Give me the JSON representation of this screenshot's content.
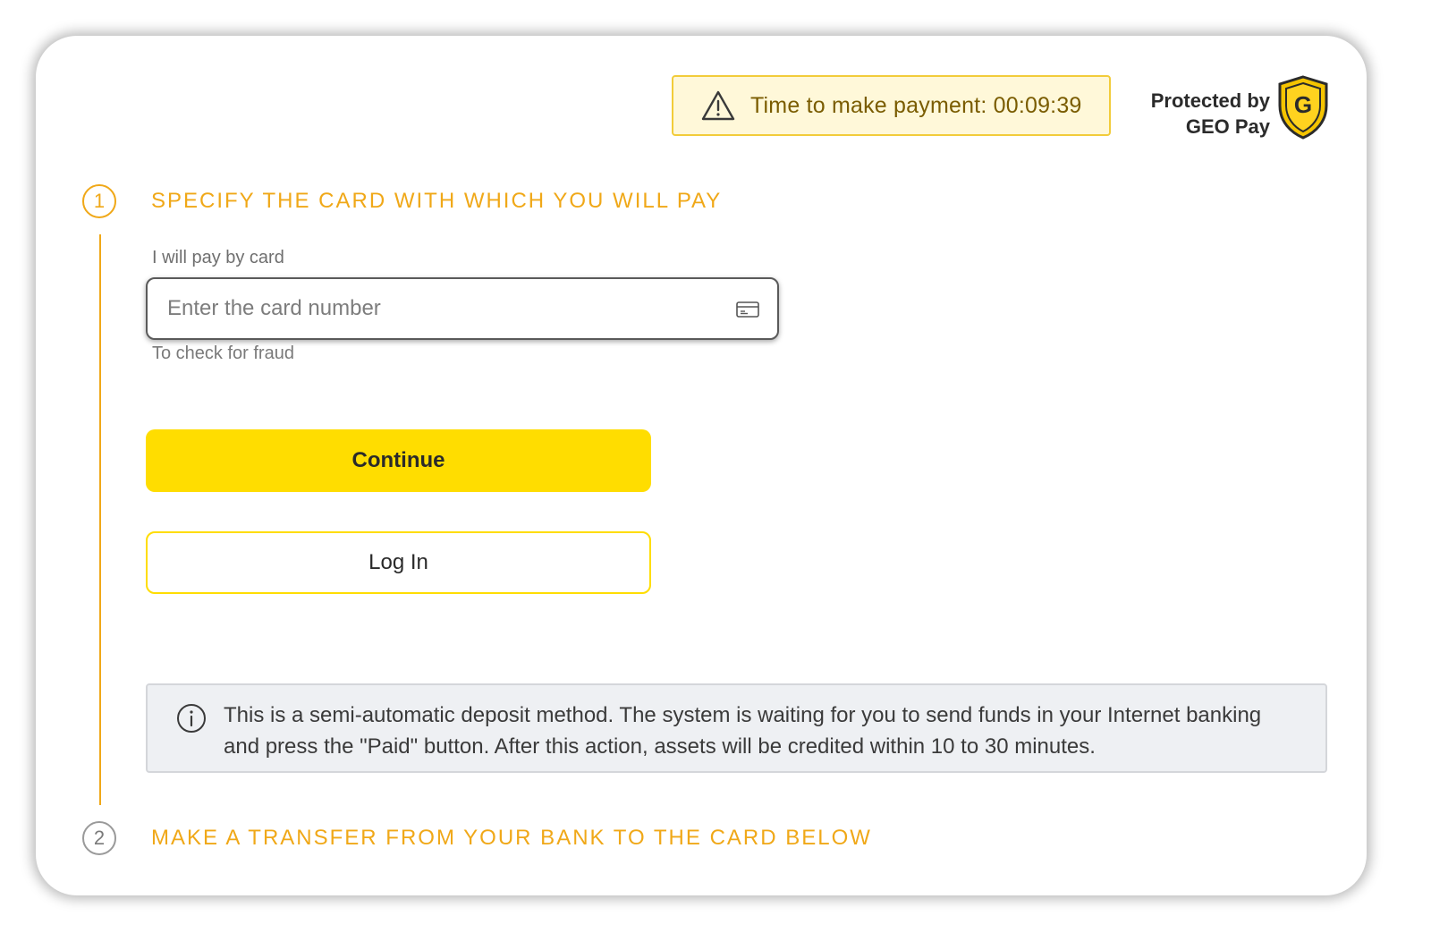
{
  "timer": {
    "label": "Time to make payment: 00:09:39",
    "icon": "warning-triangle-icon"
  },
  "protection": {
    "line1": "Protected by",
    "line2": "GEO Pay",
    "logo_letter": "G",
    "logo_icon": "shield-icon"
  },
  "steps": [
    {
      "number": "1",
      "title": "SPECIFY THE CARD WITH WHICH YOU WILL PAY",
      "active": true
    },
    {
      "number": "2",
      "title": "MAKE A TRANSFER FROM YOUR BANK TO THE CARD BELOW",
      "active": false
    }
  ],
  "card_field": {
    "label": "I will pay by card",
    "placeholder": "Enter the card number",
    "value": "",
    "hint": "To check for fraud",
    "icon": "credit-card-icon"
  },
  "buttons": {
    "continue": "Continue",
    "login": "Log In"
  },
  "info": {
    "icon": "info-icon",
    "text": "This is a semi-automatic deposit method. The system is waiting for you to send funds in your Internet banking and press the \"Paid\" button. After this action, assets will be credited within 10 to 30 minutes."
  },
  "colors": {
    "accent": "#f0a818",
    "button_yellow": "#ffdd00",
    "timer_bg": "#fff8d9",
    "timer_border": "#f2cc3a"
  }
}
